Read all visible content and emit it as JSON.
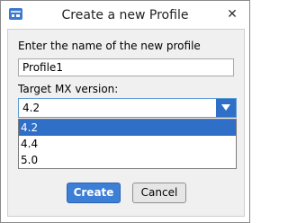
{
  "window": {
    "title": "Create a new Profile",
    "close_glyph": "✕"
  },
  "form": {
    "name_label": "Enter the name of the new profile",
    "name_value": "Profile1",
    "version_label": "Target MX version:",
    "version_selected": "4.2",
    "version_options": [
      "4.2",
      "4.4",
      "5.0"
    ]
  },
  "buttons": {
    "create": "Create",
    "cancel": "Cancel"
  },
  "colors": {
    "accent": "#2f6fc7",
    "create_button": "#3d7fd6"
  }
}
